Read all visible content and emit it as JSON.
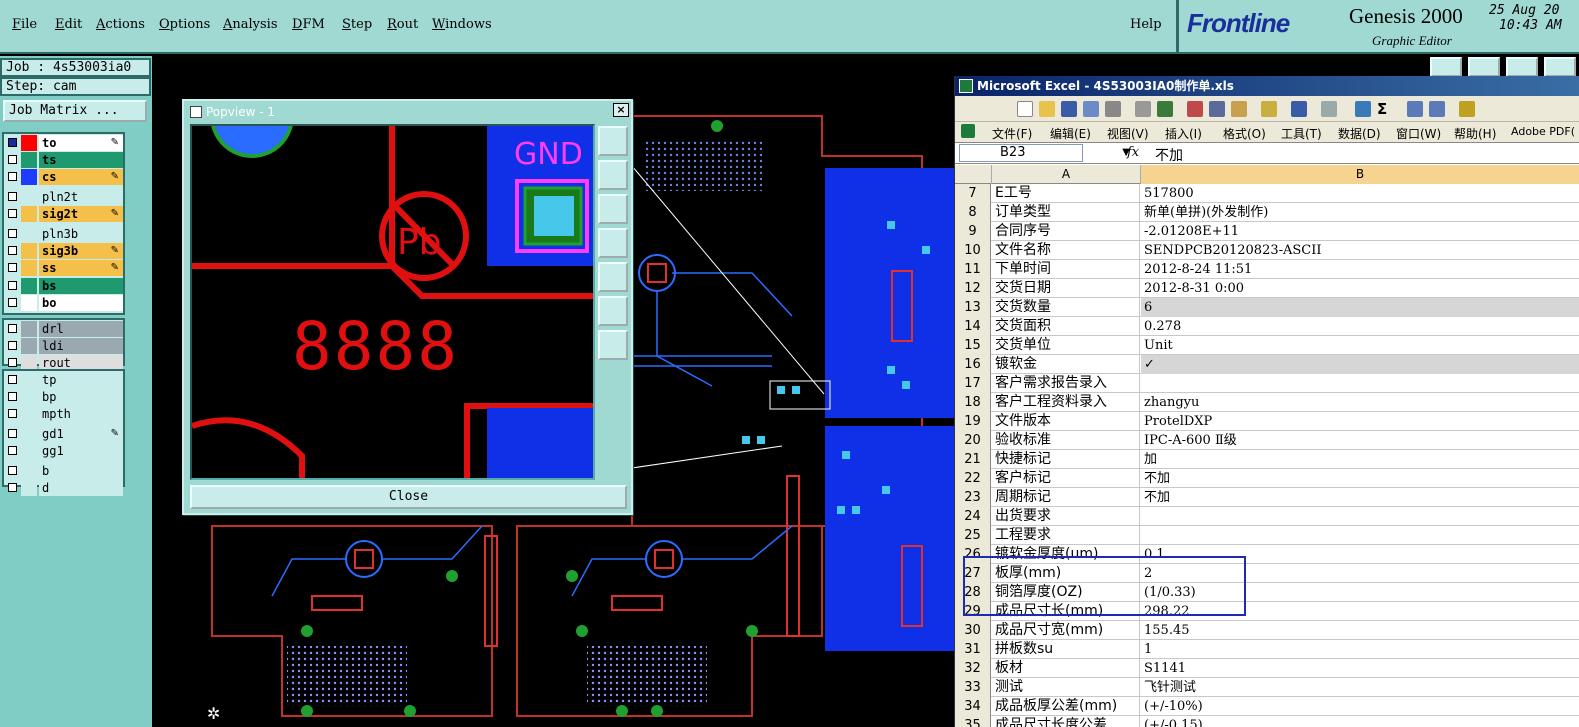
{
  "menubar": {
    "items": [
      {
        "label": "File",
        "u": "F",
        "rest": "ile"
      },
      {
        "label": "Edit",
        "u": "E",
        "rest": "dit"
      },
      {
        "label": "Actions",
        "u": "A",
        "rest": "ctions"
      },
      {
        "label": "Options",
        "u": "O",
        "rest": "ptions"
      },
      {
        "label": "Analysis",
        "u": "A",
        "rest": "nalysis"
      },
      {
        "label": "DFM",
        "u": "D",
        "rest": "FM"
      },
      {
        "label": "Step",
        "u": "S",
        "rest": "tep"
      },
      {
        "label": "Rout",
        "u": "R",
        "rest": "out"
      },
      {
        "label": "Windows",
        "u": "W",
        "rest": "indows"
      }
    ],
    "help": "Help"
  },
  "brand": {
    "logo": "Frontline",
    "product": "Genesis 2000",
    "subtitle": "Graphic Editor",
    "date": "25 Aug 20",
    "time": "10:43 AM"
  },
  "job": {
    "job_line": "Job : 4s53003ia0",
    "step_line": "Step: cam",
    "matrix_button": "Job Matrix ..."
  },
  "layers": {
    "group1": [
      {
        "name": "to",
        "bg": "#ffffff",
        "swatch": "#ff0000",
        "edit": true
      },
      {
        "name": "ts",
        "bg": "#1f9a6e",
        "swatch": "#1f9a6e",
        "edit": false
      },
      {
        "name": "cs",
        "bg": "#f5c04a",
        "swatch": "#1e3cff",
        "edit": true
      },
      {
        "name": "pln2t",
        "bg": "#c8ecea",
        "swatch": "",
        "edit": false,
        "plain": true
      },
      {
        "name": "sig2t",
        "bg": "#f5c04a",
        "swatch": "",
        "edit": true
      },
      {
        "name": "pln3b",
        "bg": "#c8ecea",
        "swatch": "",
        "edit": false,
        "plain": true
      },
      {
        "name": "sig3b",
        "bg": "#f5c04a",
        "swatch": "",
        "edit": true
      },
      {
        "name": "ss",
        "bg": "#f5c04a",
        "swatch": "",
        "edit": true
      },
      {
        "name": "bs",
        "bg": "#1f9a6e",
        "swatch": "",
        "edit": false
      },
      {
        "name": "bo",
        "bg": "#ffffff",
        "swatch": "",
        "edit": false
      }
    ],
    "group2": [
      {
        "name": "drl",
        "bg": "#9aa8b0",
        "edit": false,
        "plain": true
      },
      {
        "name": "ldi",
        "bg": "#9aa8b0",
        "edit": false,
        "plain": true
      },
      {
        "name": "rout",
        "bg": "#dedede",
        "edit": false,
        "plain": true
      }
    ],
    "group3": [
      {
        "name": "tp",
        "bg": "#c8ecea",
        "edit": false,
        "plain": true
      },
      {
        "name": "bp",
        "bg": "#c8ecea",
        "edit": false,
        "plain": true
      },
      {
        "name": "mpth",
        "bg": "#c8ecea",
        "edit": false,
        "plain": true
      },
      {
        "name": "gd1",
        "bg": "#c8ecea",
        "edit": true,
        "plain": true
      },
      {
        "name": "gg1",
        "bg": "#c8ecea",
        "edit": false,
        "plain": true
      },
      {
        "name": "b",
        "bg": "#c8ecea",
        "edit": false,
        "plain": true
      },
      {
        "name": "d",
        "bg": "#c8ecea",
        "edit": false,
        "plain": true
      }
    ]
  },
  "popview": {
    "title": "Popview - 1",
    "close_button": "Close",
    "canvas_gnd": "GND",
    "canvas_pb": "Pb",
    "canvas_digits": "8888"
  },
  "excel": {
    "title": "Microsoft Excel - 4S53003IA0制作单.xls",
    "menus": [
      "文件(F)",
      "编辑(E)",
      "视图(V)",
      "插入(I)",
      "格式(O)",
      "工具(T)",
      "数据(D)",
      "窗口(W)",
      "帮助(H)",
      "Adobe PDF("
    ],
    "namebox": "B23",
    "fx": "fx",
    "formula_value": "不加",
    "col_a": "A",
    "col_b": "B",
    "rows": [
      {
        "n": "7",
        "a": "E工号",
        "b": "517800"
      },
      {
        "n": "8",
        "a": "订单类型",
        "b": "新单(单拼)(外发制作)"
      },
      {
        "n": "9",
        "a": "合同序号",
        "b": "-2.01208E+11"
      },
      {
        "n": "10",
        "a": "文件名称",
        "b": "SENDPCB20120823-ASCII"
      },
      {
        "n": "11",
        "a": "下单时间",
        "b": "2012-8-24 11:51"
      },
      {
        "n": "12",
        "a": "交货日期",
        "b": "2012-8-31 0:00"
      },
      {
        "n": "13",
        "a": "交货数量",
        "b": "6",
        "shaded": true
      },
      {
        "n": "14",
        "a": "交货面积",
        "b": "0.278"
      },
      {
        "n": "15",
        "a": "交货单位",
        "b": "Unit"
      },
      {
        "n": "16",
        "a": "镀软金",
        "b": "✓",
        "shaded": true
      },
      {
        "n": "17",
        "a": "客户需求报告录入",
        "b": ""
      },
      {
        "n": "18",
        "a": "客户工程资料录入",
        "b": "zhangyu"
      },
      {
        "n": "19",
        "a": "文件版本",
        "b": "ProtelDXP"
      },
      {
        "n": "20",
        "a": "验收标准",
        "b": "IPC-A-600 Ⅱ级"
      },
      {
        "n": "21",
        "a": "快捷标记",
        "b": "加"
      },
      {
        "n": "22",
        "a": "客户标记",
        "b": "不加"
      },
      {
        "n": "23",
        "a": "周期标记",
        "b": "不加"
      },
      {
        "n": "24",
        "a": "出货要求",
        "b": ""
      },
      {
        "n": "25",
        "a": "工程要求",
        "b": ""
      },
      {
        "n": "26",
        "a": "镀软金厚度(um)",
        "b": "0.1"
      },
      {
        "n": "27",
        "a": "板厚(mm)",
        "b": "2"
      },
      {
        "n": "28",
        "a": "铜箔厚度(OZ)",
        "b": "(1/0.33)"
      },
      {
        "n": "29",
        "a": "成品尺寸长(mm)",
        "b": "298.22"
      },
      {
        "n": "30",
        "a": "成品尺寸宽(mm)",
        "b": "155.45"
      },
      {
        "n": "31",
        "a": "拼板数su",
        "b": "1"
      },
      {
        "n": "32",
        "a": "板材",
        "b": "S1141"
      },
      {
        "n": "33",
        "a": "测试",
        "b": "飞针测试"
      },
      {
        "n": "34",
        "a": "成品板厚公差(mm)",
        "b": "(+/-10%)"
      },
      {
        "n": "35",
        "a": "成品尺寸长度公差",
        "b": "(+/-0.15)"
      }
    ]
  }
}
